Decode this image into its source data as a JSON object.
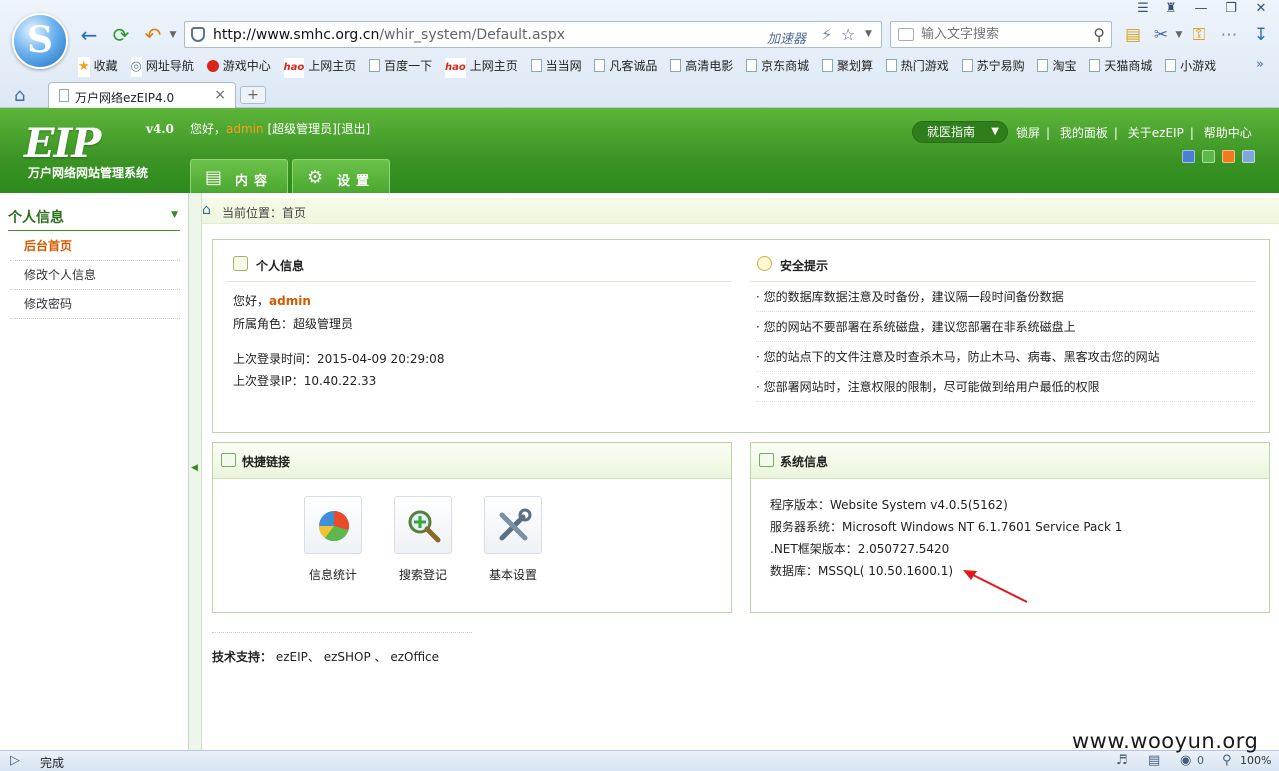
{
  "browser": {
    "url": "http://www.smhc.org.cn/whir_system/Default.aspx",
    "url_host": "http://www.smhc.org.cn",
    "url_path": "/whir_system/Default.aspx",
    "accelerator_label": "加速器",
    "search_placeholder": "输入文字搜索",
    "bookmarks": [
      "收藏",
      "网址导航",
      "游戏中心",
      "上网主页",
      "百度一下",
      "上网主页",
      "当当网",
      "凡客诚品",
      "高清电影",
      "京东商城",
      "聚划算",
      "热门游戏",
      "苏宁易购",
      "淘宝",
      "天猫商城",
      "小游戏"
    ],
    "tab_title": "万户网络ezEIP4.0",
    "tab_close": "×",
    "new_tab": "+",
    "status_text": "完成",
    "zoom": "100%",
    "status_counter": "0"
  },
  "header": {
    "brand": "EIP",
    "brand_version": "v4.0",
    "brand_sub": "万户网络网站管理系统",
    "greeting_prefix": "您好，",
    "username": "admin",
    "role_link": "[超级管理员]",
    "logout_link": "[退出]",
    "tabs": [
      {
        "label": "内容"
      },
      {
        "label": "设置"
      }
    ],
    "guide_select": "就医指南",
    "top_links": [
      "锁屏",
      "我的面板",
      "关于ezEIP",
      "帮助中心"
    ],
    "skin_colors": [
      "#4a7fd4",
      "#5cb84a",
      "#f07a1e",
      "#7fa7d8"
    ]
  },
  "sidebar": {
    "heading": "个人信息",
    "items": [
      {
        "label": "后台首页"
      },
      {
        "label": "修改个人信息"
      },
      {
        "label": "修改密码"
      }
    ]
  },
  "breadcrumb": "当前位置：首页",
  "personal": {
    "title": "个人信息",
    "greeting_prefix": "您好，",
    "username": "admin",
    "role": "所属角色：超级管理员",
    "last_login_time": "上次登录时间：2015-04-09 20:29:08",
    "last_login_ip": "上次登录IP：10.40.22.33"
  },
  "security": {
    "title": "安全提示",
    "tips": [
      "· 您的数据库数据注意及时备份，建议隔一段时间备份数据",
      "· 您的网站不要部署在系统磁盘，建议您部署在非系统磁盘上",
      "· 您的站点下的文件注意及时查杀木马，防止木马、病毒、黑客攻击您的网站",
      "· 您部署网站时，注意权限的限制，尽可能做到给用户最低的权限"
    ]
  },
  "quick_links": {
    "title": "快捷链接",
    "items": [
      {
        "label": "信息统计"
      },
      {
        "label": "搜索登记"
      },
      {
        "label": "基本设置"
      }
    ]
  },
  "system_info": {
    "title": "系统信息",
    "lines": [
      "程序版本：Website System v4.0.5(5162)",
      "服务器系统：Microsoft Windows NT 6.1.7601 Service Pack 1",
      ".NET框架版本：2.050727.5420",
      "数据库：MSSQL( 10.50.1600.1)"
    ]
  },
  "support": {
    "label": "技术支持：",
    "links": "ezEIP、 ezSHOP 、 ezOffice"
  },
  "watermark": "www.wooyun.org"
}
